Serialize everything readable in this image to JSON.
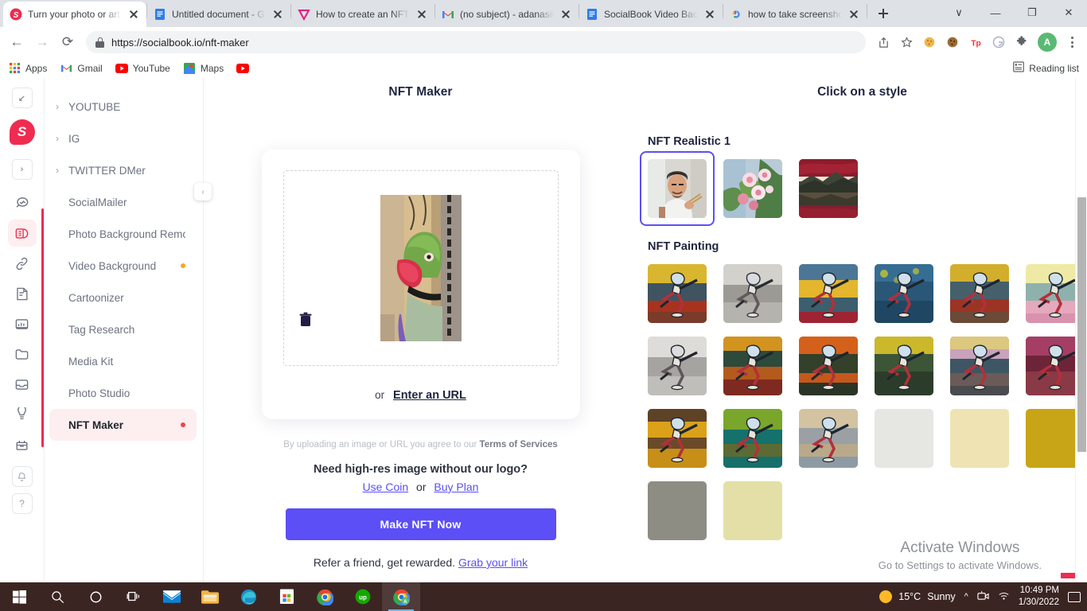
{
  "browser": {
    "tabs": [
      {
        "title": "Turn your photo or art",
        "favicon": "socialbook-icon",
        "active": true
      },
      {
        "title": "Untitled document - G",
        "favicon": "google-docs-icon",
        "active": false
      },
      {
        "title": "How to create an NFT",
        "favicon": "vimeo-icon",
        "active": false
      },
      {
        "title": "(no subject) - adanasit",
        "favicon": "gmail-icon",
        "active": false
      },
      {
        "title": "SocialBook Video Back",
        "favicon": "google-docs-icon",
        "active": false
      },
      {
        "title": "how to take screensho",
        "favicon": "google-search-icon",
        "active": false
      }
    ],
    "new_tab_label": "+",
    "window_controls": {
      "list": "∨",
      "minimize": "—",
      "maximize": "❐",
      "close": "✕"
    },
    "nav": {
      "back": "←",
      "forward": "→",
      "reload": "⟳"
    },
    "url": "https://socialbook.io/nft-maker",
    "toolbar_icons": [
      "share-icon",
      "bookmark-star-icon",
      "cookie-icon",
      "cookie-dark-icon",
      "tp-extension-icon",
      "grammarly-icon",
      "extensions-puzzle-icon"
    ],
    "profile_initial": "A",
    "bookmarks": [
      {
        "label": "Apps",
        "icon": "apps-grid-icon"
      },
      {
        "label": "Gmail",
        "icon": "gmail-icon"
      },
      {
        "label": "YouTube",
        "icon": "youtube-icon"
      },
      {
        "label": "Maps",
        "icon": "maps-icon"
      },
      {
        "label": "",
        "icon": "youtube-icon"
      }
    ],
    "reading_list": "Reading list"
  },
  "rail": {
    "collapse_glyph": "↙",
    "brand_letter": "S",
    "expand_glyph": "›",
    "icons": [
      {
        "name": "search-insights-icon",
        "active": false
      },
      {
        "name": "palette-icon",
        "active": true
      },
      {
        "name": "link-icon",
        "active": false
      },
      {
        "name": "note-icon",
        "active": false
      },
      {
        "name": "analytics-icon",
        "active": false
      },
      {
        "name": "folder-icon",
        "active": false
      },
      {
        "name": "inbox-icon",
        "active": false
      },
      {
        "name": "crown-icon",
        "active": false
      },
      {
        "name": "gift-icon",
        "active": false
      }
    ],
    "bell_glyph": "⌂",
    "help_glyph": "?"
  },
  "sidebar": {
    "collapse_glyph": "‹",
    "items": [
      {
        "label": "YOUTUBE",
        "expandable": true,
        "dot": "",
        "active": false
      },
      {
        "label": "IG",
        "expandable": true,
        "dot": "",
        "active": false
      },
      {
        "label": "TWITTER DMer",
        "expandable": true,
        "dot": "",
        "active": false
      },
      {
        "label": "SocialMailer",
        "expandable": false,
        "dot": "",
        "active": false
      },
      {
        "label": "Photo Background Remover",
        "expandable": false,
        "dot": "",
        "active": false
      },
      {
        "label": "Video Background",
        "expandable": false,
        "dot": "#f5a623",
        "active": false
      },
      {
        "label": "Cartoonizer",
        "expandable": false,
        "dot": "",
        "active": false
      },
      {
        "label": "Tag Research",
        "expandable": false,
        "dot": "",
        "active": false
      },
      {
        "label": "Media Kit",
        "expandable": false,
        "dot": "",
        "active": false
      },
      {
        "label": "Photo Studio",
        "expandable": false,
        "dot": "",
        "active": false
      },
      {
        "label": "NFT Maker",
        "expandable": false,
        "dot": "#ef4444",
        "active": true
      }
    ]
  },
  "maker": {
    "title": "NFT Maker",
    "uploaded_image_alt": "green-parrot-photo",
    "delete_icon": "trash-icon",
    "or_text": "or",
    "url_link": "Enter an URL",
    "tos_prefix": "By uploading an image or URL you agree to our ",
    "tos_link": "Terms of Services",
    "highres_question": "Need high-res image without our logo?",
    "use_coin": "Use Coin",
    "coin_or": "or",
    "buy_plan": "Buy Plan",
    "cta_label": "Make NFT Now",
    "refer_text": "Refer a friend, get rewarded.",
    "refer_link": "Grab your link",
    "cta_color": "#5b4ff5"
  },
  "styles": {
    "title": "Click on a style",
    "groups": [
      {
        "name": "NFT Realistic 1",
        "thumbs": [
          {
            "alt": "man-with-paintbrush-portrait",
            "selected": true,
            "watermark": false
          },
          {
            "alt": "pink-blossom-flowers",
            "selected": false,
            "watermark": true
          },
          {
            "alt": "red-sky-mountain-lake",
            "selected": false,
            "watermark": true
          }
        ]
      },
      {
        "name": "NFT Painting",
        "thumbs": [
          {
            "alt": "painting-yellow-red-field",
            "selected": false,
            "watermark": false
          },
          {
            "alt": "painting-greyscale-pencil",
            "selected": false,
            "watermark": false
          },
          {
            "alt": "painting-yellow-blue-crimson",
            "selected": false,
            "watermark": false
          },
          {
            "alt": "painting-blue-teal",
            "selected": false,
            "watermark": false
          },
          {
            "alt": "painting-gold-slate",
            "selected": false,
            "watermark": false
          },
          {
            "alt": "painting-pastel-yellow-teal",
            "selected": false,
            "watermark": false
          },
          {
            "alt": "painting-soft-grey",
            "selected": false,
            "watermark": false
          },
          {
            "alt": "painting-orange-olive-red",
            "selected": false,
            "watermark": false
          },
          {
            "alt": "painting-orange-dark-green",
            "selected": false,
            "watermark": false
          },
          {
            "alt": "painting-yellow-forest",
            "selected": false,
            "watermark": false
          },
          {
            "alt": "painting-pastel-lilac-blue",
            "selected": false,
            "watermark": false
          },
          {
            "alt": "painting-magenta-maroon",
            "selected": false,
            "watermark": false
          },
          {
            "alt": "painting-amber-brown",
            "selected": false,
            "watermark": false
          },
          {
            "alt": "painting-green-teal-grass",
            "selected": false,
            "watermark": false
          },
          {
            "alt": "painting-sandy-beige",
            "selected": false,
            "watermark": false
          },
          {
            "alt": "painting-row4-white",
            "selected": false,
            "watermark": false
          },
          {
            "alt": "painting-row4-cream",
            "selected": false,
            "watermark": false
          },
          {
            "alt": "painting-row4-gold",
            "selected": false,
            "watermark": false
          },
          {
            "alt": "painting-row4-grey",
            "selected": false,
            "watermark": false
          },
          {
            "alt": "painting-row4-pale",
            "selected": false,
            "watermark": false
          }
        ]
      }
    ]
  },
  "windows_watermark": {
    "line1": "Activate Windows",
    "line2": "Go to Settings to activate Windows."
  },
  "taskbar": {
    "items": [
      {
        "name": "start-button",
        "icon": "windows-logo-icon"
      },
      {
        "name": "search-button",
        "icon": "search-icon"
      },
      {
        "name": "cortana-button",
        "icon": "cortana-circle-icon"
      },
      {
        "name": "task-view-button",
        "icon": "task-view-icon"
      },
      {
        "name": "mail-app",
        "icon": "mail-icon"
      },
      {
        "name": "file-explorer",
        "icon": "folder-icon"
      },
      {
        "name": "edge-browser",
        "icon": "edge-icon"
      },
      {
        "name": "microsoft-store",
        "icon": "store-icon"
      },
      {
        "name": "chrome-browser",
        "icon": "chrome-icon"
      },
      {
        "name": "upwork-app",
        "icon": "upwork-icon"
      },
      {
        "name": "chrome-active-window",
        "icon": "chrome-profile-icon"
      }
    ],
    "weather_temp": "15°C",
    "weather_desc": "Sunny",
    "tray_icons": [
      "chevron-up-icon",
      "camera-icon",
      "wifi-icon"
    ],
    "time": "10:49 PM",
    "date": "1/30/2022",
    "notification": "notification-icon"
  }
}
